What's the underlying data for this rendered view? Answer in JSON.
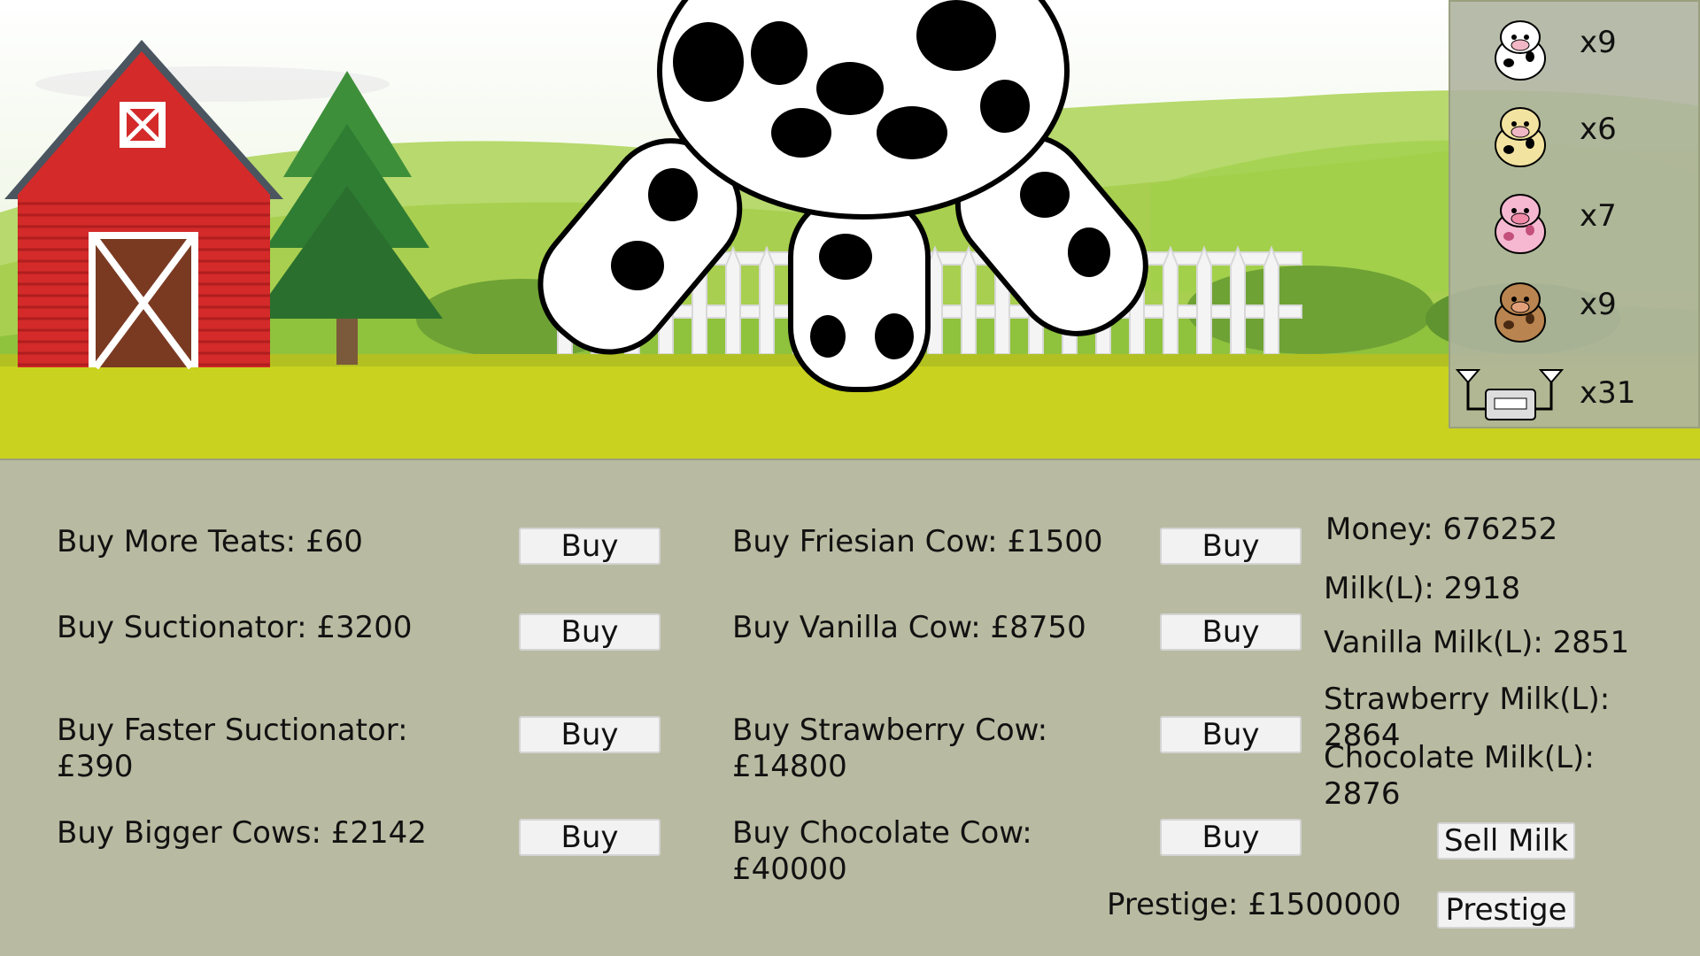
{
  "upgrades": [
    {
      "label": "Buy More Teats: £60",
      "button": "Buy"
    },
    {
      "label": "Buy Suctionator: £3200",
      "button": "Buy"
    },
    {
      "label": "Buy Faster Suctionator:\n£390",
      "button": "Buy"
    },
    {
      "label": "Buy Bigger Cows: £2142",
      "button": "Buy"
    }
  ],
  "cows": [
    {
      "label": "Buy Friesian Cow: £1500",
      "button": "Buy"
    },
    {
      "label": "Buy Vanilla Cow: £8750",
      "button": "Buy"
    },
    {
      "label": "Buy Strawberry Cow:\n£14800",
      "button": "Buy"
    },
    {
      "label": "Buy Chocolate Cow:\n£40000",
      "button": "Buy"
    }
  ],
  "stats": {
    "money": "Money: 676252",
    "milk": "Milk(L): 2918",
    "vanilla": "Vanilla Milk(L): 2851",
    "strawberry": "Strawberry Milk(L):\n2864",
    "chocolate": "Chocolate Milk(L):\n2876"
  },
  "actions": {
    "sell": "Sell Milk",
    "prestige_label": "Prestige: £1500000",
    "prestige_button": "Prestige"
  },
  "inventory": [
    {
      "icon": "friesian-cow-icon",
      "count": "x9",
      "color": "#ffffff"
    },
    {
      "icon": "vanilla-cow-icon",
      "count": "x6",
      "color": "#f3e3a0"
    },
    {
      "icon": "strawberry-cow-icon",
      "count": "x7",
      "color": "#f6b8d0"
    },
    {
      "icon": "chocolate-cow-icon",
      "count": "x9",
      "color": "#b9844f"
    },
    {
      "icon": "suctionator-icon",
      "count": "x31",
      "color": "#dddddd"
    }
  ],
  "colors": {
    "barn": "#d42a2a",
    "grass": "#c9d21e",
    "panel": "#a8ac8c"
  }
}
